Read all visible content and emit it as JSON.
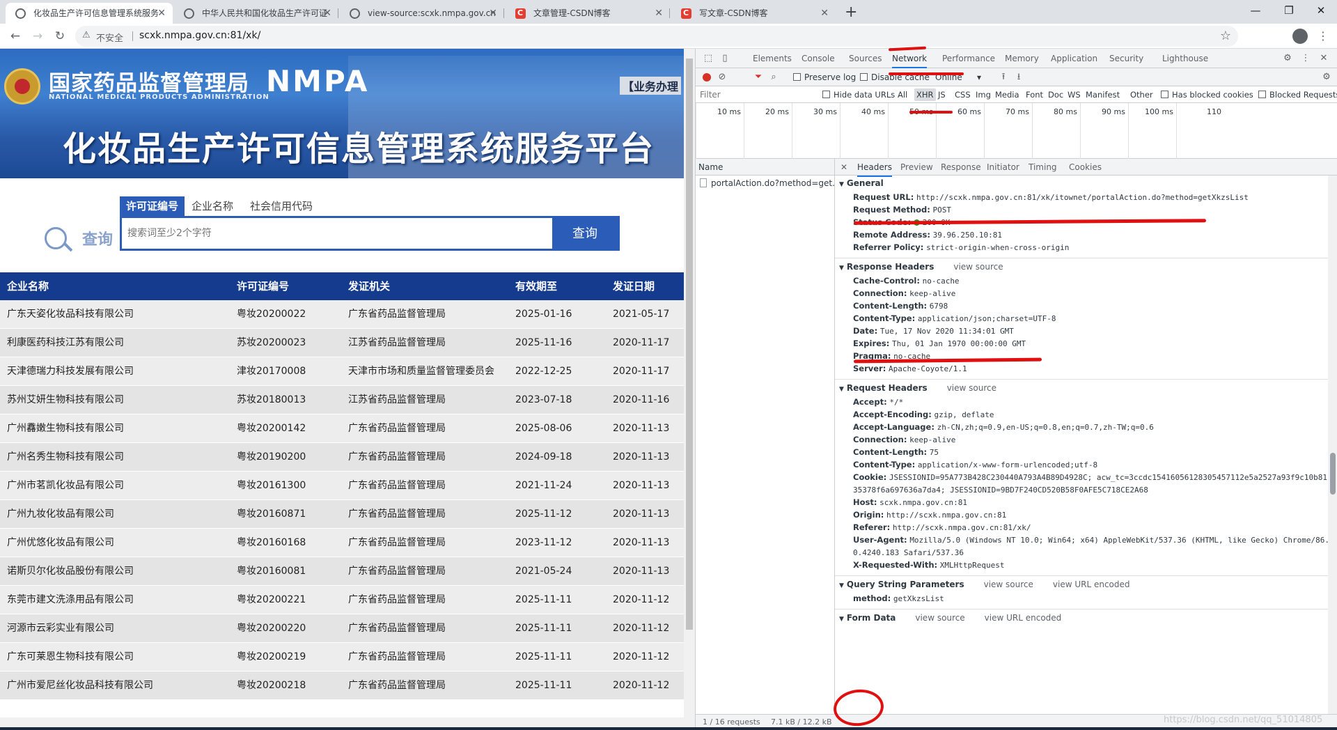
{
  "browser": {
    "tabs": [
      {
        "title": "化妆品生产许可信息管理系统服务",
        "icon": "globe-icon"
      },
      {
        "title": "中华人民共和国化妆品生产许可证",
        "icon": "globe-icon"
      },
      {
        "title": "view-source:scxk.nmpa.gov.cn",
        "icon": "globe-icon"
      },
      {
        "title": "文章管理-CSDN博客",
        "icon": "csdn-icon"
      },
      {
        "title": "写文章-CSDN博客",
        "icon": "csdn-icon"
      }
    ],
    "security_label": "不安全",
    "url": "scxk.nmpa.gov.cn:81/xk/"
  },
  "page": {
    "agency_name_cn": "国家药品监督管理局",
    "agency_name_en": "NATIONAL MEDICAL PRODUCTS ADMINISTRATION",
    "logo_text": "NMPA",
    "service_tag": "【业务办理",
    "platform_title": "化妆品生产许可信息管理系统服务平台",
    "search": {
      "tabs": [
        "许可证编号",
        "企业名称",
        "社会信用代码"
      ],
      "logo_text": "查询",
      "placeholder": "搜索词至少2个字符",
      "button": "查询"
    },
    "table": {
      "headers": [
        "企业名称",
        "许可证编号",
        "发证机关",
        "有效期至",
        "发证日期"
      ],
      "rows": [
        [
          "广东天姿化妆品科技有限公司",
          "粤妆20200022",
          "广东省药品监督管理局",
          "2025-01-16",
          "2021-05-17"
        ],
        [
          "利康医药科技江苏有限公司",
          "苏妆20200023",
          "江苏省药品监督管理局",
          "2025-11-16",
          "2020-11-17"
        ],
        [
          "天津德瑞力科技发展有限公司",
          "津妆20170008",
          "天津市市场和质量监督管理委员会",
          "2022-12-25",
          "2020-11-17"
        ],
        [
          "苏州艾妍生物科技有限公司",
          "苏妆20180013",
          "江苏省药品监督管理局",
          "2023-07-18",
          "2020-11-16"
        ],
        [
          "广州馫嫩生物科技有限公司",
          "粤妆20200142",
          "广东省药品监督管理局",
          "2025-08-06",
          "2020-11-13"
        ],
        [
          "广州名秀生物科技有限公司",
          "粤妆20190200",
          "广东省药品监督管理局",
          "2024-09-18",
          "2020-11-13"
        ],
        [
          "广州市茗凯化妆品有限公司",
          "粤妆20161300",
          "广东省药品监督管理局",
          "2021-11-24",
          "2020-11-13"
        ],
        [
          "广州九妆化妆品有限公司",
          "粤妆20160871",
          "广东省药品监督管理局",
          "2025-11-12",
          "2020-11-13"
        ],
        [
          "广州优悠化妆品有限公司",
          "粤妆20160168",
          "广东省药品监督管理局",
          "2023-11-12",
          "2020-11-13"
        ],
        [
          "诺斯贝尔化妆品股份有限公司",
          "粤妆20160081",
          "广东省药品监督管理局",
          "2021-05-24",
          "2020-11-13"
        ],
        [
          "东莞市建文洗涤用品有限公司",
          "粤妆20200221",
          "广东省药品监督管理局",
          "2025-11-11",
          "2020-11-12"
        ],
        [
          "河源市云彩实业有限公司",
          "粤妆20200220",
          "广东省药品监督管理局",
          "2025-11-11",
          "2020-11-12"
        ],
        [
          "广东可莱恩生物科技有限公司",
          "粤妆20200219",
          "广东省药品监督管理局",
          "2025-11-11",
          "2020-11-12"
        ],
        [
          "广州市爱尼丝化妆品科技有限公司",
          "粤妆20200218",
          "广东省药品监督管理局",
          "2025-11-11",
          "2020-11-12"
        ]
      ]
    }
  },
  "devtools": {
    "tabs": [
      "Elements",
      "Console",
      "Sources",
      "Network",
      "Performance",
      "Memory",
      "Application",
      "Security",
      "Lighthouse"
    ],
    "active_tab": "Network",
    "toolbar": {
      "preserve_log": "Preserve log",
      "disable_cache": "Disable cache",
      "throttle": "Online"
    },
    "filter_placeholder": "Filter",
    "hide_data_urls": "Hide data URLs",
    "filter_types": [
      "All",
      "XHR",
      "JS",
      "CSS",
      "Img",
      "Media",
      "Font",
      "Doc",
      "WS",
      "Manifest",
      "Other"
    ],
    "has_blocked_cookies": "Has blocked cookies",
    "blocked_requests": "Blocked Requests",
    "timeline_ticks": [
      "10 ms",
      "20 ms",
      "30 ms",
      "40 ms",
      "50 ms",
      "60 ms",
      "70 ms",
      "80 ms",
      "90 ms",
      "100 ms",
      "110"
    ],
    "name_column": "Name",
    "request_name": "portalAction.do?method=get...",
    "detail_tabs": [
      "Headers",
      "Preview",
      "Response",
      "Initiator",
      "Timing",
      "Cookies"
    ],
    "general": {
      "title": "General",
      "items": [
        {
          "k": "Request URL:",
          "v": "http://scxk.nmpa.gov.cn:81/xk/itownet/portalAction.do?method=getXkzsList"
        },
        {
          "k": "Request Method:",
          "v": "POST"
        },
        {
          "k": "Status Code:",
          "v": "200 OK"
        },
        {
          "k": "Remote Address:",
          "v": "39.96.250.10:81"
        },
        {
          "k": "Referrer Policy:",
          "v": "strict-origin-when-cross-origin"
        }
      ]
    },
    "response_headers": {
      "title": "Response Headers",
      "view_source": "view source",
      "items": [
        {
          "k": "Cache-Control:",
          "v": "no-cache"
        },
        {
          "k": "Connection:",
          "v": "keep-alive"
        },
        {
          "k": "Content-Length:",
          "v": "6798"
        },
        {
          "k": "Content-Type:",
          "v": "application/json;charset=UTF-8"
        },
        {
          "k": "Date:",
          "v": "Tue, 17 Nov 2020 11:34:01 GMT"
        },
        {
          "k": "Expires:",
          "v": "Thu, 01 Jan 1970 00:00:00 GMT"
        },
        {
          "k": "Pragma:",
          "v": "no-cache"
        },
        {
          "k": "Server:",
          "v": "Apache-Coyote/1.1"
        }
      ]
    },
    "request_headers": {
      "title": "Request Headers",
      "view_source": "view source",
      "items": [
        {
          "k": "Accept:",
          "v": "*/*"
        },
        {
          "k": "Accept-Encoding:",
          "v": "gzip, deflate"
        },
        {
          "k": "Accept-Language:",
          "v": "zh-CN,zh;q=0.9,en-US;q=0.8,en;q=0.7,zh-TW;q=0.6"
        },
        {
          "k": "Connection:",
          "v": "keep-alive"
        },
        {
          "k": "Content-Length:",
          "v": "75"
        },
        {
          "k": "Content-Type:",
          "v": "application/x-www-form-urlencoded;utf-8"
        },
        {
          "k": "Cookie:",
          "v": "JSESSIONID=95A773B428C230440A793A4B89D4928C; acw_tc=3ccdc15416056128305457112e5a2527a93f9c10b81"
        },
        {
          "k": "",
          "v": "35378f6a697636a7da4; JSESSIONID=9BD7F240CD520B58F0AFE5C718CE2A68"
        },
        {
          "k": "Host:",
          "v": "scxk.nmpa.gov.cn:81"
        },
        {
          "k": "Origin:",
          "v": "http://scxk.nmpa.gov.cn:81"
        },
        {
          "k": "Referer:",
          "v": "http://scxk.nmpa.gov.cn:81/xk/"
        },
        {
          "k": "User-Agent:",
          "v": "Mozilla/5.0 (Windows NT 10.0; Win64; x64) AppleWebKit/537.36 (KHTML, like Gecko) Chrome/86."
        },
        {
          "k": "",
          "v": "0.4240.183 Safari/537.36"
        },
        {
          "k": "X-Requested-With:",
          "v": "XMLHttpRequest"
        }
      ]
    },
    "query_string": {
      "title": "Query String Parameters",
      "view_source": "view source",
      "view_url_encoded": "view URL encoded",
      "items": [
        {
          "k": "method:",
          "v": "getXkzsList"
        }
      ]
    },
    "form_data": {
      "title": "Form Data",
      "view_source": "view source",
      "view_url_encoded": "view URL encoded"
    },
    "status_bar": {
      "requests": "1 / 16 requests",
      "transferred": "7.1 kB / 12.2 kB"
    },
    "watermark": "https://blog.csdn.net/qq_51014805"
  }
}
